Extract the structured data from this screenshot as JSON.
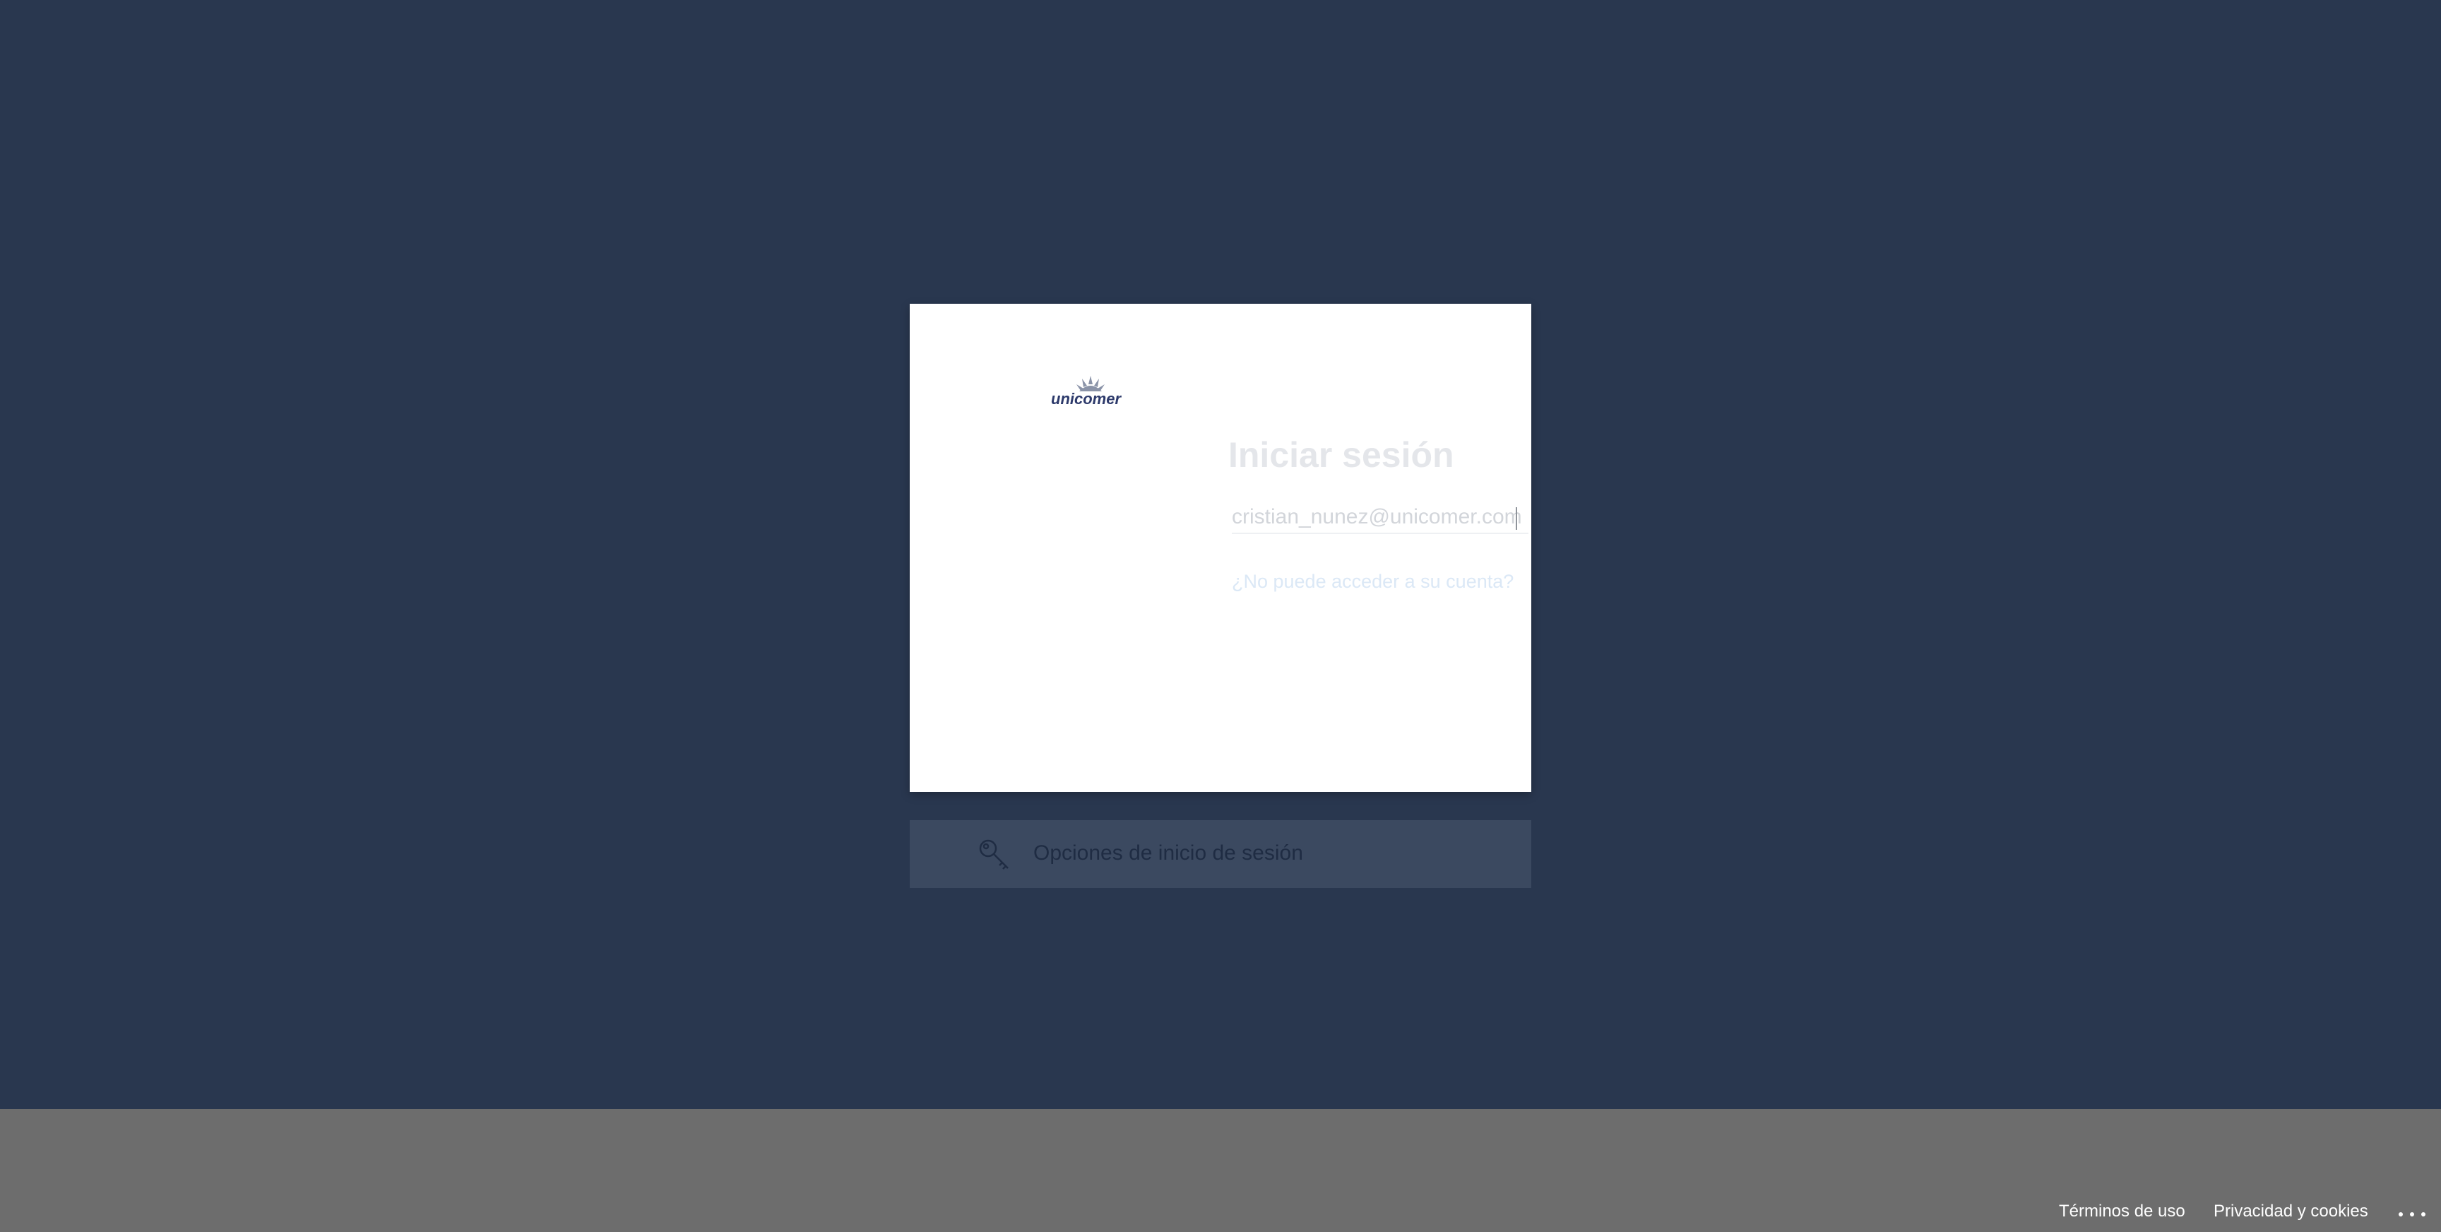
{
  "logo": {
    "text": "unicomer"
  },
  "signin": {
    "title": "Iniciar sesión",
    "email_value": "cristian_nunez@unicomer.com",
    "cant_access_link": "¿No puede acceder a su cuenta?"
  },
  "options": {
    "label": "Opciones de inicio de sesión",
    "icon": "key-icon"
  },
  "footer": {
    "terms": "Términos de uso",
    "privacy": "Privacidad y cookies",
    "more_icon": "ellipsis-icon"
  },
  "colors": {
    "page_background": "#29374f",
    "footer_background": "#6d6d6d",
    "card_background": "#ffffff",
    "logo_blue": "#2d3a6b"
  }
}
